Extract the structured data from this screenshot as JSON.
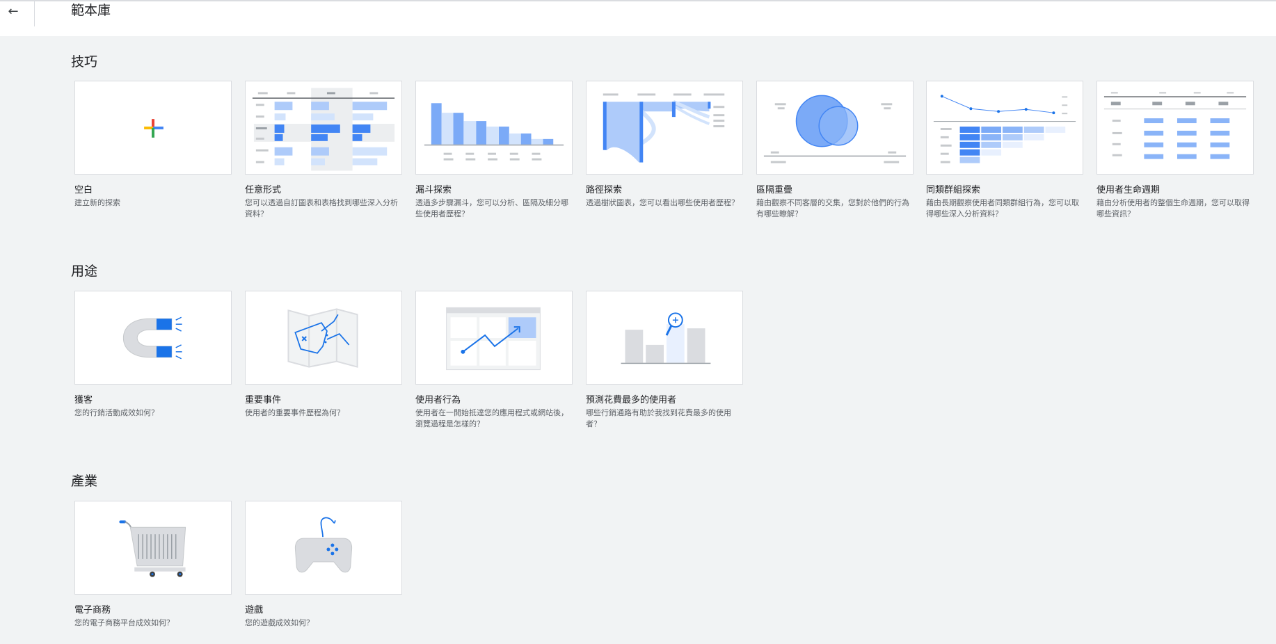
{
  "header": {
    "back_icon": "←",
    "title": "範本庫"
  },
  "sections": [
    {
      "title": "技巧",
      "cards": [
        {
          "title": "空白",
          "desc": "建立新的探索",
          "icon": "plus-icon"
        },
        {
          "title": "任意形式",
          "desc": "您可以透過自訂圖表和表格找到哪些深入分析資料？",
          "icon": "table-icon"
        },
        {
          "title": "漏斗探索",
          "desc": "透過多步驟漏斗，您可以分析、區隔及細分哪些使用者歷程？",
          "icon": "funnel-icon"
        },
        {
          "title": "路徑探索",
          "desc": "透過樹狀圖表，您可以看出哪些使用者歷程？",
          "icon": "path-icon"
        },
        {
          "title": "區隔重疊",
          "desc": "藉由觀察不同客層的交集，您對於他們的行為有哪些瞭解？",
          "icon": "venn-icon"
        },
        {
          "title": "同類群組探索",
          "desc": "藉由長期觀察使用者同類群組行為，您可以取得哪些深入分析資料？",
          "icon": "cohort-icon"
        },
        {
          "title": "使用者生命週期",
          "desc": "藉由分析使用者的整個生命週期，您可以取得哪些資訊？",
          "icon": "lifetime-icon"
        }
      ]
    },
    {
      "title": "用途",
      "cards": [
        {
          "title": "獲客",
          "desc": "您的行銷活動成效如何？",
          "icon": "magnet-icon"
        },
        {
          "title": "重要事件",
          "desc": "使用者的重要事件歷程為何？",
          "icon": "map-icon"
        },
        {
          "title": "使用者行為",
          "desc": "使用者在一開始抵達您的應用程式或網站後，瀏覽過程是怎樣的？",
          "icon": "trend-icon"
        },
        {
          "title": "預測花費最多的使用者",
          "desc": "哪些行銷通路有助於我找到花費最多的使用者？",
          "icon": "magnifier-bars-icon"
        }
      ]
    },
    {
      "title": "產業",
      "cards": [
        {
          "title": "電子商務",
          "desc": "您的電子商務平台成效如何？",
          "icon": "cart-icon"
        },
        {
          "title": "遊戲",
          "desc": "您的遊戲成效如何？",
          "icon": "gamepad-icon"
        }
      ]
    }
  ],
  "colors": {
    "accent_blue": "#1a73e8",
    "light_blue": "#8ab4f8",
    "pale_blue": "#d2e3fc",
    "page_bg": "#f1f3f4"
  }
}
